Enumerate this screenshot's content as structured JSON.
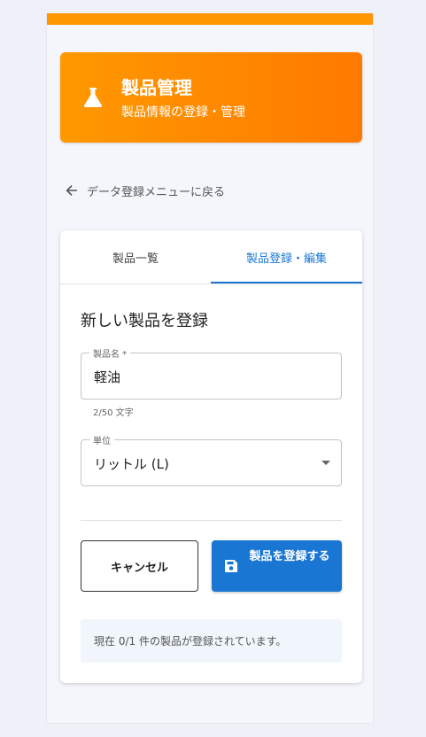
{
  "header": {
    "title": "製品管理",
    "subtitle": "製品情報の登録・管理",
    "icon": "flask-icon",
    "gradient": [
      "#ff9900",
      "#ff7a00"
    ]
  },
  "nav": {
    "back_label": "データ登録メニューに戻る"
  },
  "tabs": [
    {
      "label": "製品一覧",
      "active": false
    },
    {
      "label": "製品登録・編集",
      "active": true
    }
  ],
  "form": {
    "title": "新しい製品を登録",
    "product_name": {
      "label": "製品名 *",
      "value": "軽油",
      "helper": "2/50 文字"
    },
    "unit": {
      "label": "単位",
      "value": "リットル (L)"
    }
  },
  "actions": {
    "cancel_label": "キャンセル",
    "save_label": "製品を登録する"
  },
  "info": {
    "text": "現在 0/1 件の製品が登録されています。"
  },
  "colors": {
    "accent": "#ff9800",
    "primary": "#1976d2"
  }
}
